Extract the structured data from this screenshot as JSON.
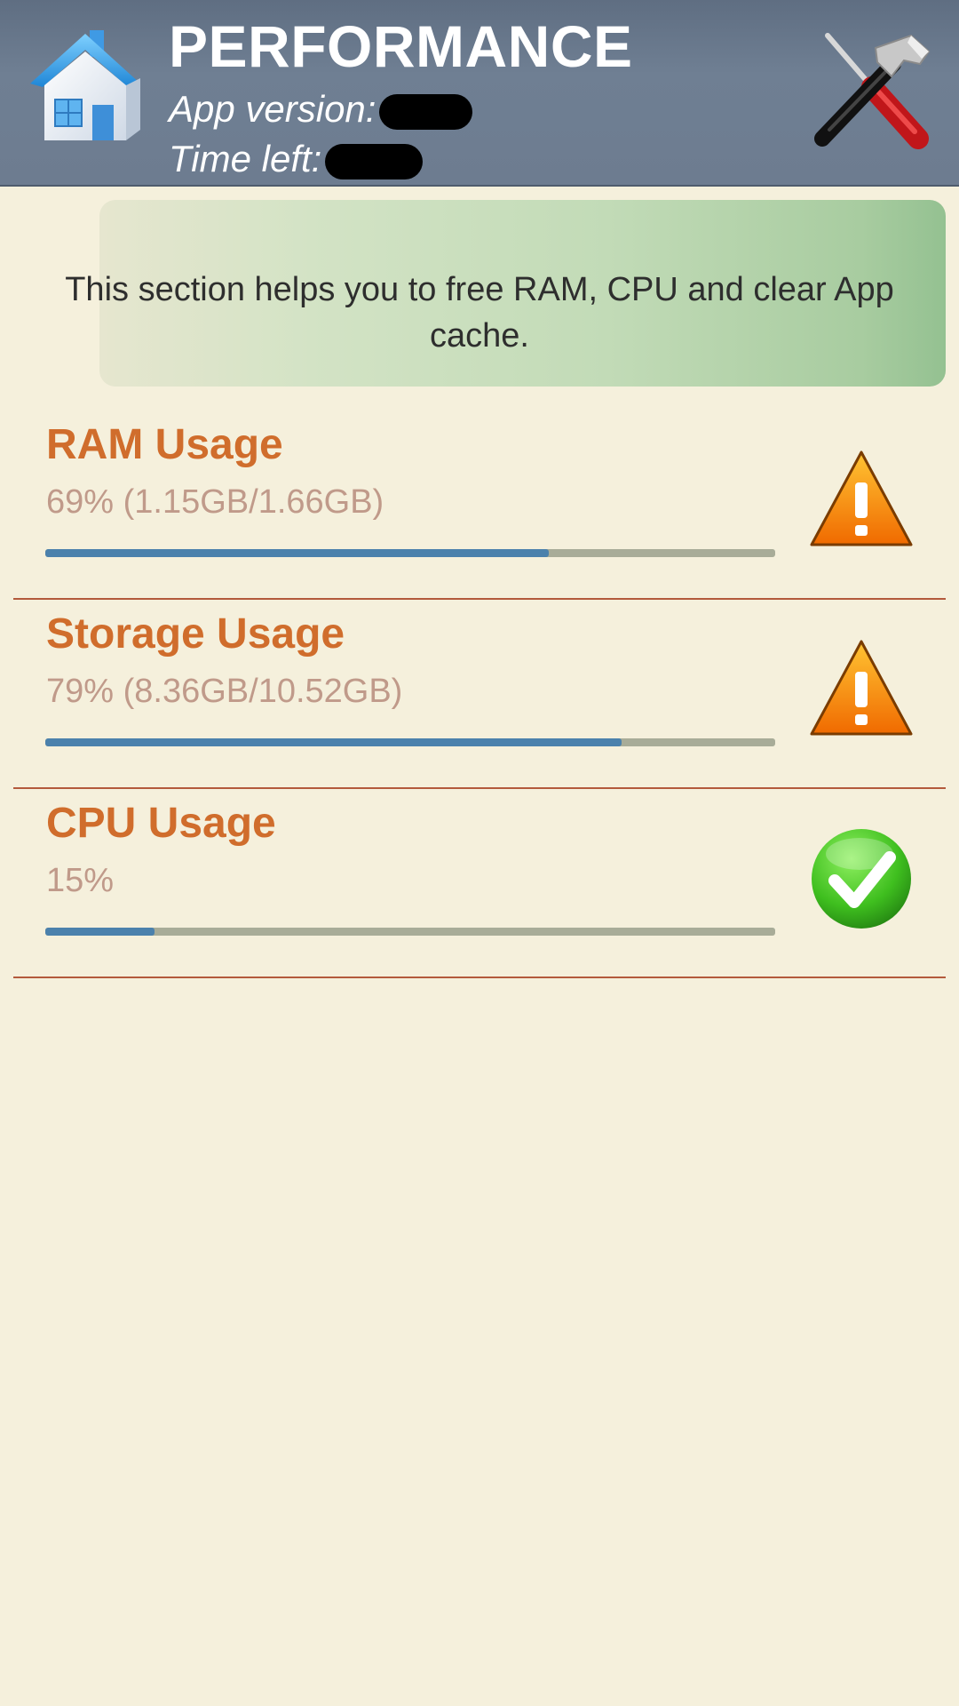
{
  "header": {
    "title": "PERFORMANCE",
    "version_label": "App version:",
    "time_left_label": "Time left:",
    "home_icon": "home-icon",
    "tools_icon": "tools-icon",
    "background_color": "#6d7c90"
  },
  "info": {
    "text": "This section helps you to free RAM, CPU and clear App cache."
  },
  "usage": [
    {
      "title": "RAM Usage",
      "detail": "69% (1.15GB/1.66GB)",
      "percent": 69,
      "status": "warning",
      "icon": "warning-icon"
    },
    {
      "title": "Storage Usage",
      "detail": "79% (8.36GB/10.52GB)",
      "percent": 79,
      "status": "warning",
      "icon": "warning-icon"
    },
    {
      "title": "CPU Usage",
      "detail": "15%",
      "percent": 15,
      "status": "ok",
      "icon": "checkmark-icon"
    }
  ],
  "colors": {
    "accent_title": "#d06d2c",
    "detail_text": "#c09a8a",
    "bar_fill": "#4b81ac",
    "bar_track": "#a8ac98",
    "divider": "#b35a3c",
    "page_background": "#f5f0dc"
  }
}
